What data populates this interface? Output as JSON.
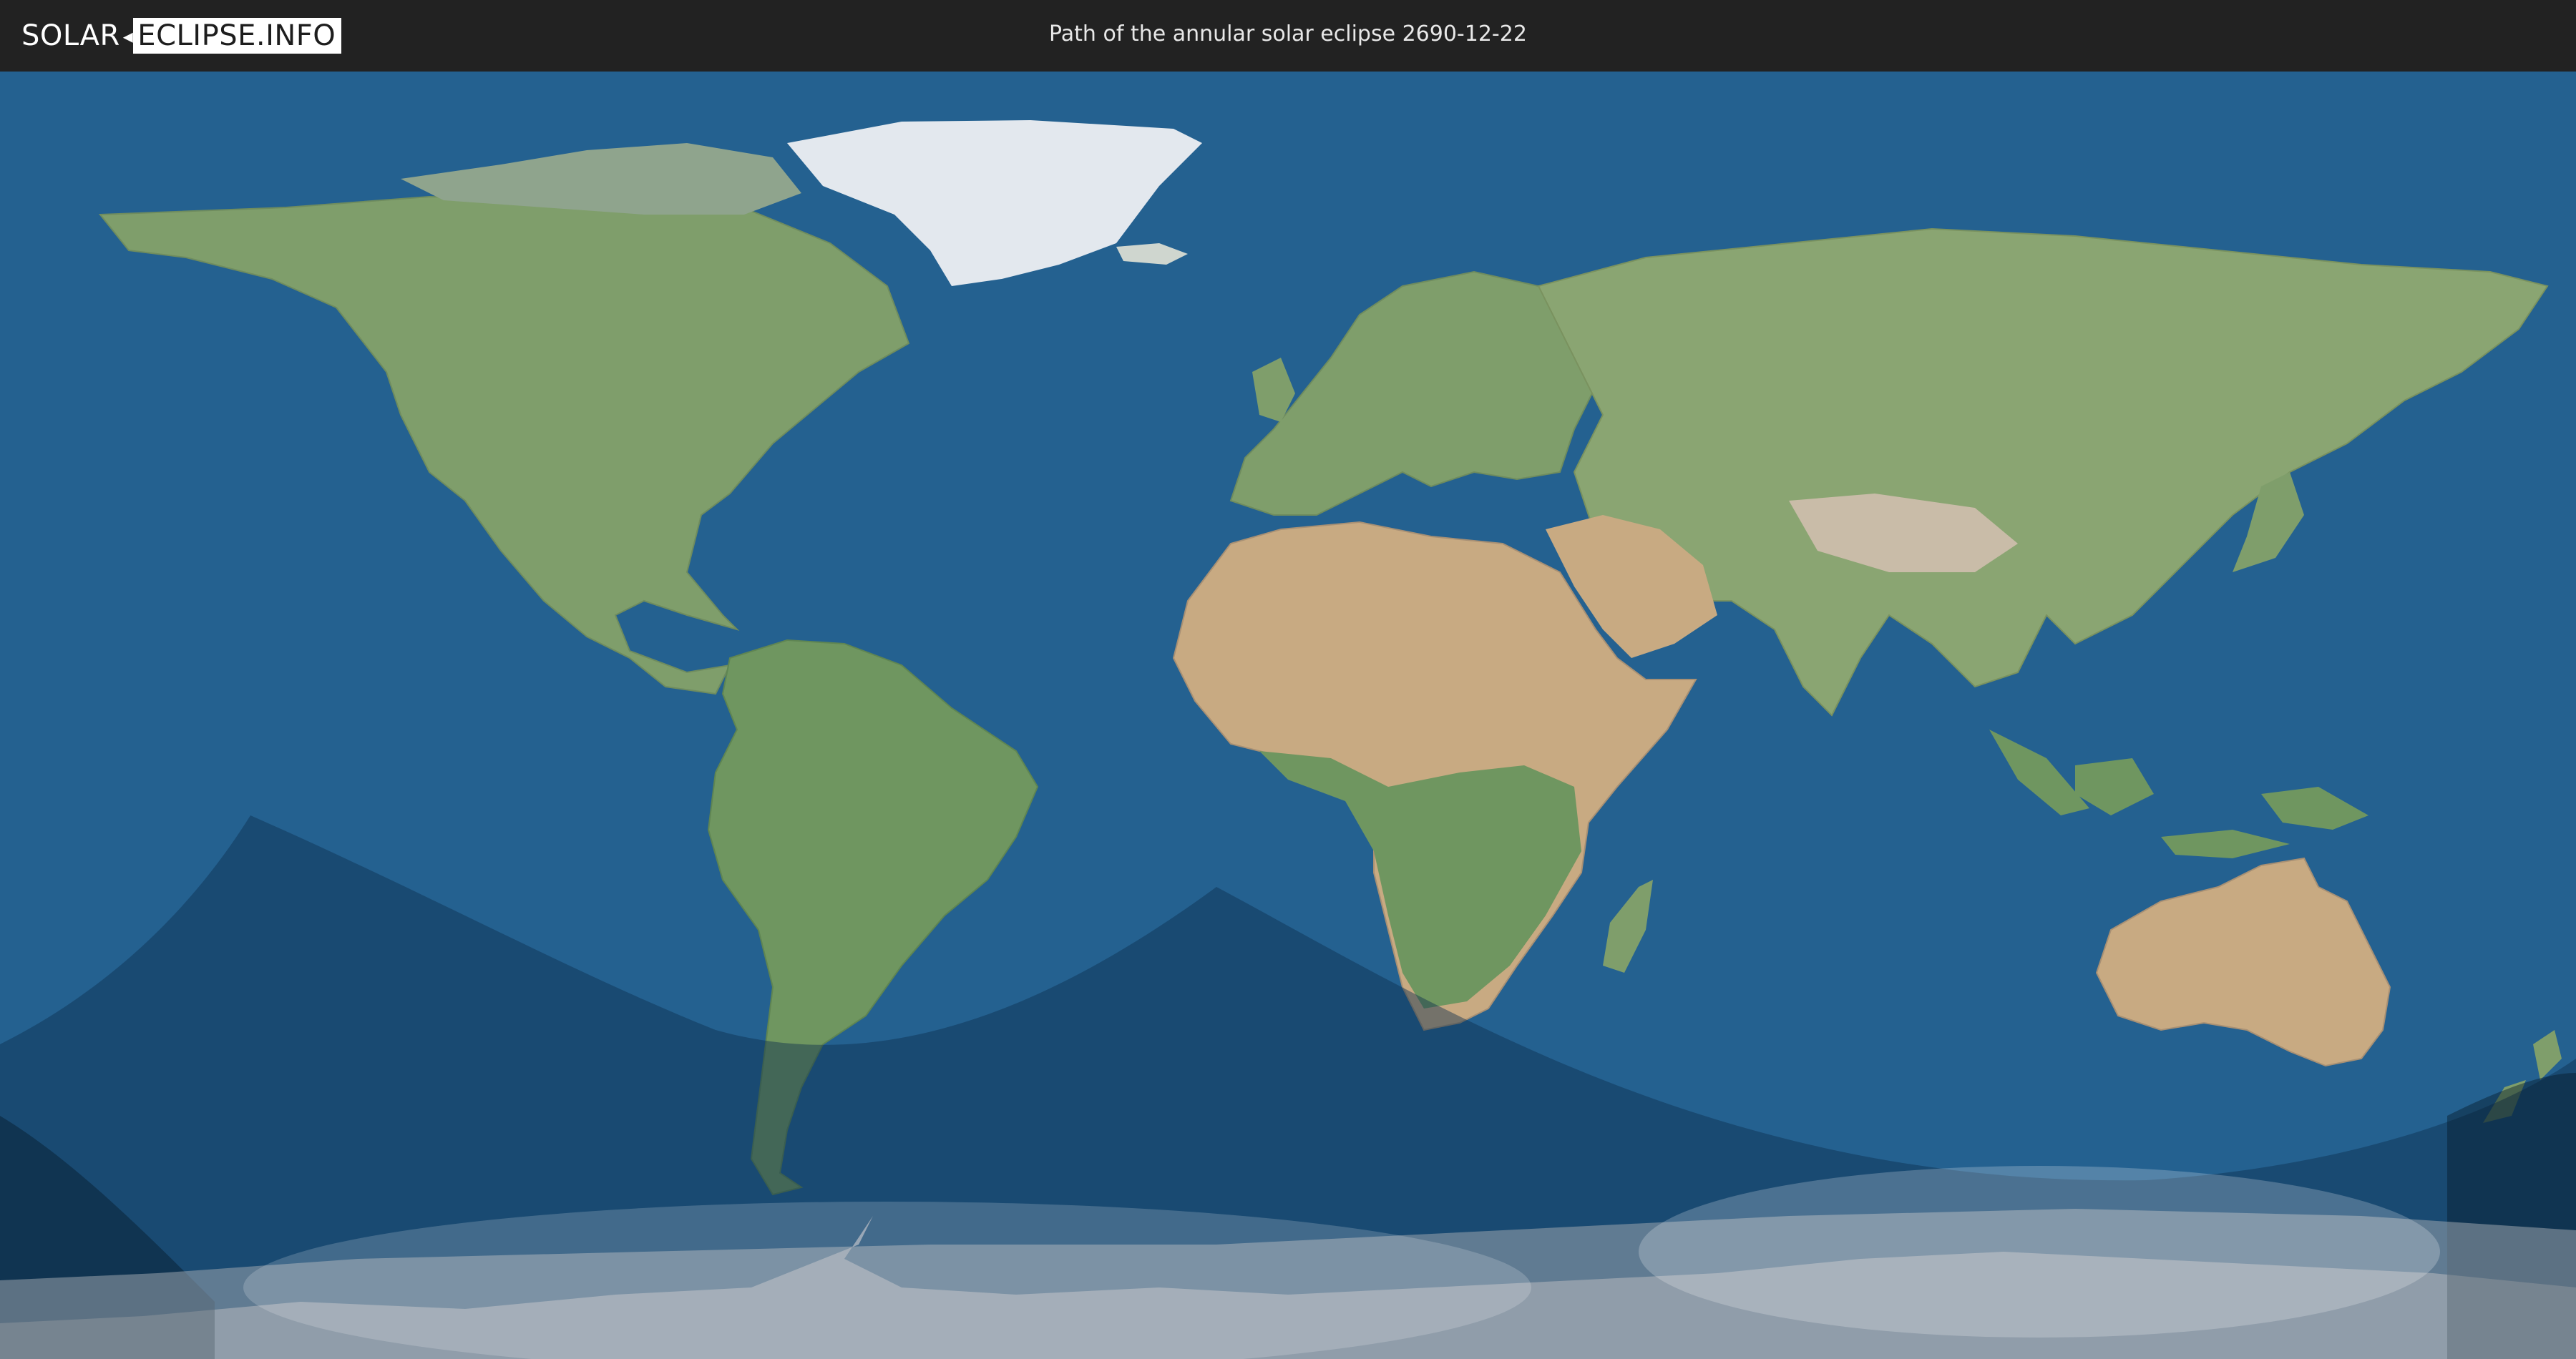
{
  "header": {
    "logo_part1": "SOLAR",
    "logo_part2": "ECLIPSE.INFO",
    "title": "Path of the annular solar eclipse 2690-12-22"
  },
  "map": {
    "projection": "equirectangular",
    "colors": {
      "ocean": "#246190",
      "land": "#7f9e6b",
      "desert": "#c8aa82",
      "ice": "#e3e8ee",
      "penumbra": "#0d2f4d",
      "night": "#061a2b",
      "antarctic_haze": "#9aa4ad"
    }
  }
}
